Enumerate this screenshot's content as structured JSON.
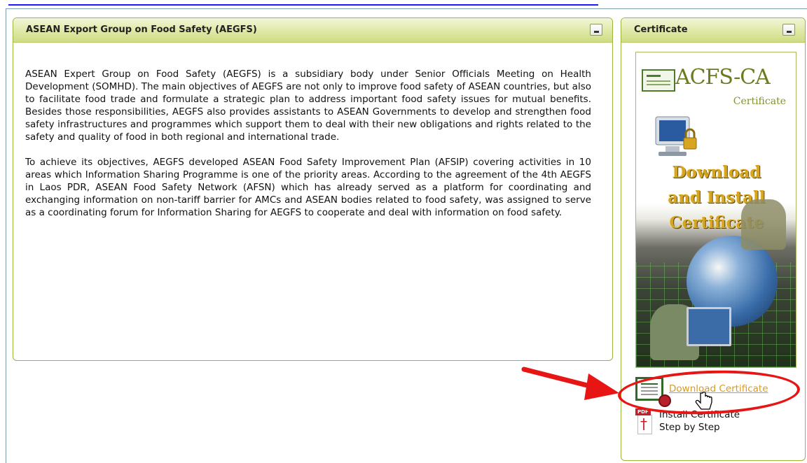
{
  "aegfs_panel": {
    "title": "ASEAN Export Group on Food Safety (AEGFS)",
    "paragraphs": [
      "ASEAN Expert Group on Food Safety (AEGFS) is a subsidiary body under Senior Officials Meeting on Health Development (SOMHD). The main objectives of AEGFS are not only to improve food safety of ASEAN countries, but also to facilitate food trade and formulate a strategic plan to address important food safety issues for mutual benefits. Besides those responsibilities, AEGFS also provides assistants to ASEAN Governments to develop and strengthen food safety infrastructures and programmes which support them to deal with their new obligations and rights related to the safety and quality of food in both regional and international trade.",
      "To achieve its objectives, AEGFS developed ASEAN Food Safety Improvement Plan (AFSIP) covering activities in 10 areas which Information Sharing Programme is one of the priority areas. According to the agreement of the 4th AEGFS in Laos PDR, ASEAN Food Safety Network (AFSN) which has already served as a platform for coordinating and exchanging information on non-tariff barrier for AMCs and ASEAN bodies related to food safety, was assigned to serve as a coordinating forum for Information Sharing for AEGFS to cooperate and deal with information on food safety."
    ]
  },
  "certificate_panel": {
    "title": "Certificate",
    "banner": {
      "brand": "ACFS-CA",
      "subtitle": "Certificate",
      "headline_lines": [
        "Download",
        "and Install",
        "Certificate"
      ]
    },
    "download_link": "Download Certificate",
    "install_lines": [
      "Install Certificate",
      "Step by Step"
    ],
    "pdf_tag": "PDF"
  },
  "colors": {
    "header_accent": "#dfe8a5",
    "panel_border": "#9ab53c",
    "link_color": "#d99b1d",
    "highlight_red": "#e81515"
  },
  "icons": {
    "minimize": "minimize-icon",
    "certificate": "certificate-icon",
    "pdf": "pdf-icon",
    "cursor": "hand-cursor-icon",
    "arrow": "red-arrow-icon"
  }
}
